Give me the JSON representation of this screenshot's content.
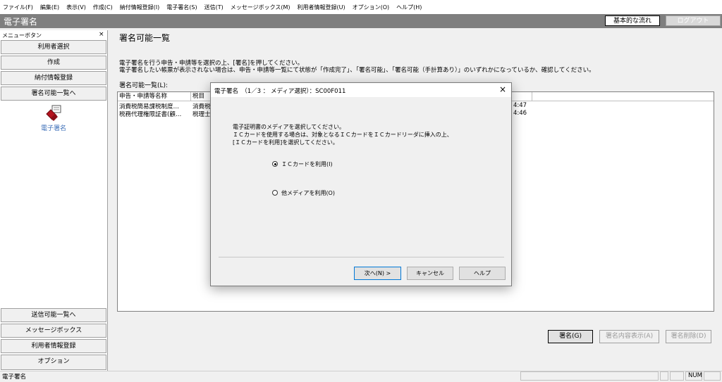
{
  "menubar": {
    "items": [
      "ファイル(F)",
      "編集(E)",
      "表示(V)",
      "作成(C)",
      "納付情報登録(I)",
      "電子署名(S)",
      "送信(T)",
      "メッセージボックス(M)",
      "利用者情報登録(U)",
      "オプション(O)",
      "ヘルプ(H)"
    ]
  },
  "titlebar": {
    "title": "電子署名",
    "flow_button": "基本的な流れ",
    "logout_button": "ログアウト"
  },
  "left_panel": {
    "caption": "メニューボタン",
    "close": "×",
    "top_buttons": [
      "利用者選択",
      "作成",
      "納付情報登録",
      "署名可能一覧へ"
    ],
    "icon_label": "電子署名",
    "bottom_buttons": [
      "送信可能一覧へ",
      "メッセージボックス",
      "利用者情報登録",
      "オプション"
    ]
  },
  "main": {
    "title": "署名可能一覧",
    "description_1": "電子署名を行う申告・申請等を選択の上、[署名]を押してください。",
    "description_2": "電子署名したい帳票が表示されない場合は、申告・申請等一覧にて状態が「作成完了」、「署名可能」、「署名可能（手計算あり）」のいずれかになっているか、確認してください。",
    "list_label": "署名可能一覧(L):",
    "columns": [
      "申告・申請等名称",
      "税目"
    ],
    "rows": [
      {
        "name": "消費税簡易課税制度…",
        "tax": "消費税",
        "time": "4:47"
      },
      {
        "name": "税務代理権限証書(顧…",
        "tax": "税理士",
        "time": "4:46"
      }
    ]
  },
  "bottom_buttons": {
    "sign": "署名(G)",
    "detail": "署名内容表示(A)",
    "delete": "署名削除(D)"
  },
  "statusbar": {
    "text": "電子署名",
    "num": "NUM"
  },
  "dialog": {
    "title": "電子署名　（1／3 ： メディア選択）：SC00F011",
    "close": "×",
    "message_1": "電子証明書のメディアを選択してください。",
    "message_2": "ＩＣカードを使用する場合は、対象となるＩＣカードをＩＣカードリーダに挿入の上、",
    "message_3": "[ＩＣカードを利用]を選択してください。",
    "option_ic": "ＩＣカードを利用(I)",
    "option_other": "他メディアを利用(O)",
    "selected": "ic",
    "next_button": "次へ(N) >",
    "cancel_button": "キャンセル",
    "help_button": "ヘルプ"
  }
}
